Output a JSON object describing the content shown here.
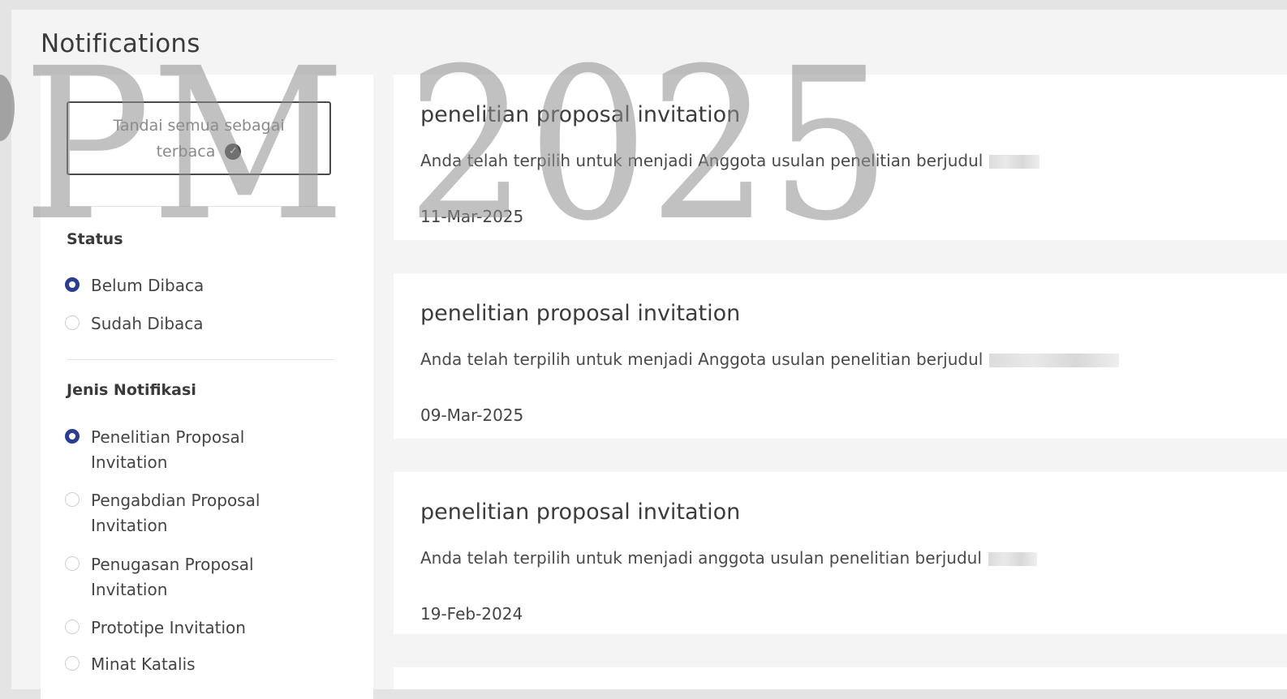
{
  "page": {
    "title": "Notifications"
  },
  "sidebar": {
    "mark_all_label": "Tandai semua sebagai terbaca",
    "status": {
      "title": "Status",
      "options": [
        {
          "label": "Belum Dibaca",
          "selected": true
        },
        {
          "label": "Sudah Dibaca",
          "selected": false
        }
      ]
    },
    "types": {
      "title": "Jenis Notifikasi",
      "options": [
        {
          "label": "Penelitian Proposal Invitation",
          "selected": true
        },
        {
          "label": "Pengabdian Proposal Invitation",
          "selected": false
        },
        {
          "label": "Penugasan Proposal Invitation",
          "selected": false
        },
        {
          "label": "Prototipe Invitation",
          "selected": false
        },
        {
          "label": "Minat Katalis",
          "selected": false
        }
      ]
    }
  },
  "notifications": [
    {
      "title": "penelitian proposal invitation",
      "message": "Anda telah terpilih untuk menjadi Anggota usulan penelitian berjudul",
      "date": "11-Mar-2025"
    },
    {
      "title": "penelitian proposal invitation",
      "message": "Anda telah terpilih untuk menjadi Anggota usulan penelitian berjudul",
      "date": "09-Mar-2025"
    },
    {
      "title": "penelitian proposal invitation",
      "message": "Anda telah terpilih untuk menjadi anggota usulan penelitian berjudul",
      "date": "19-Feb-2024"
    }
  ],
  "watermark": {
    "text": "PM 2025"
  },
  "colors": {
    "radio_selected": "#2a3d8f",
    "background": "#f4f4f4"
  }
}
